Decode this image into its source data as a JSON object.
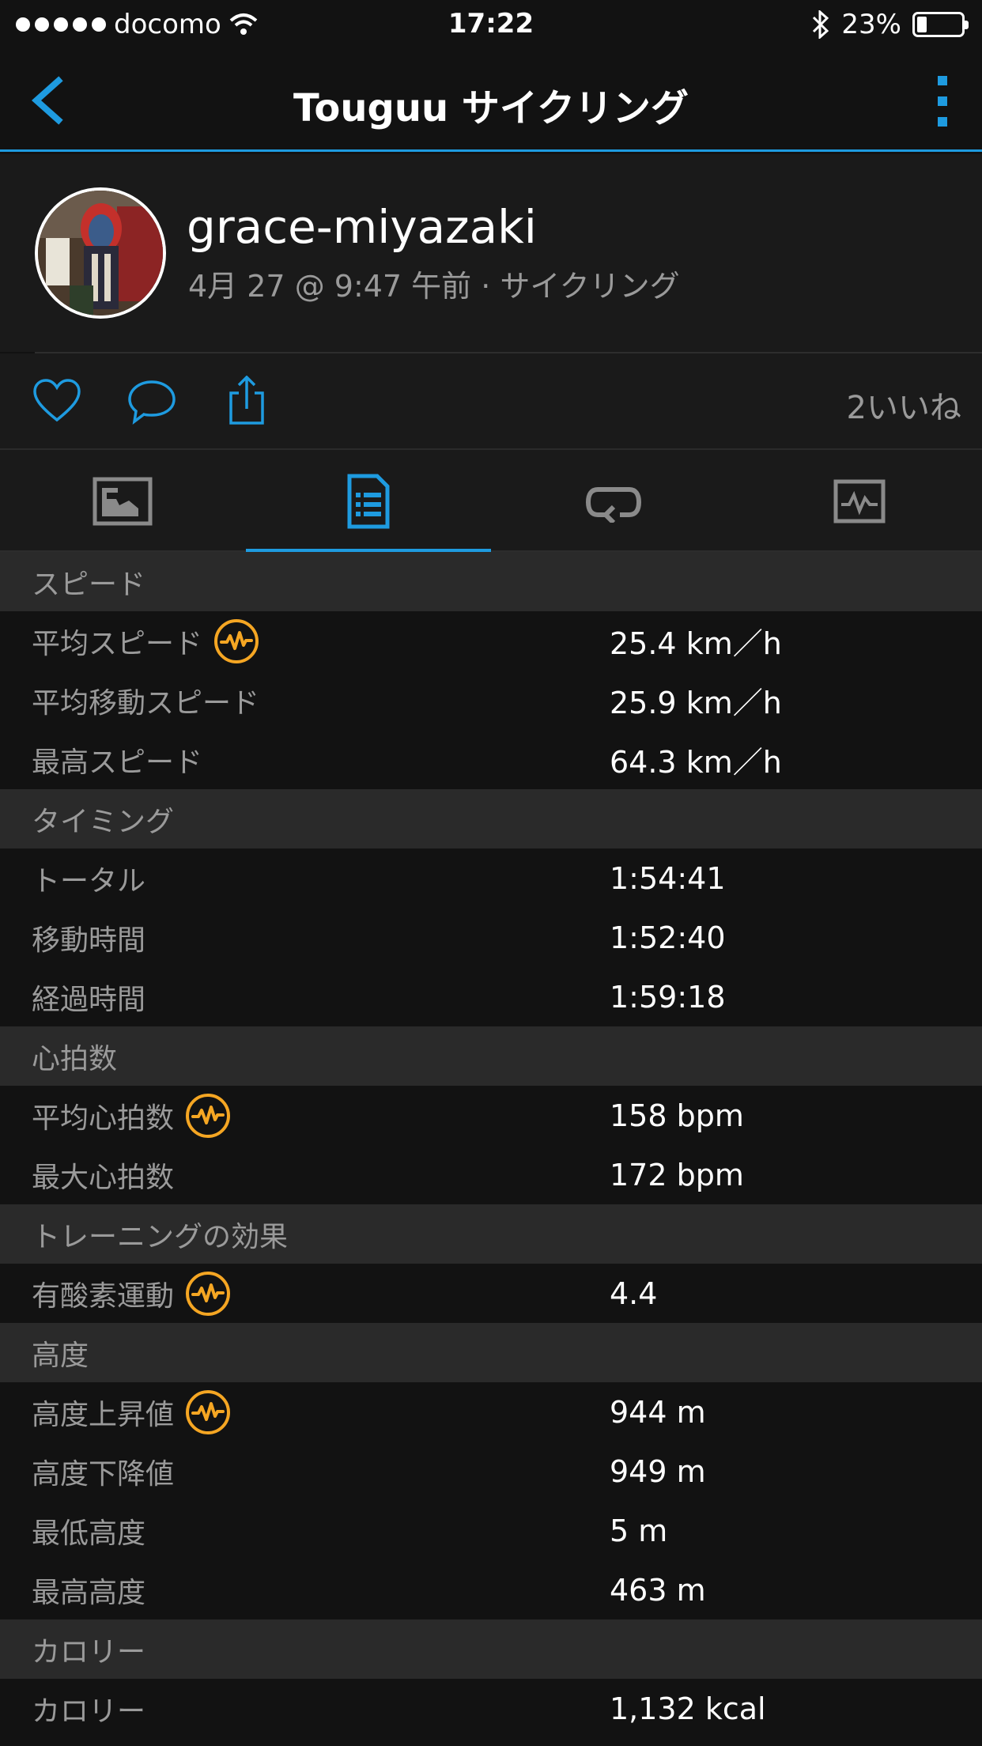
{
  "status_bar": {
    "carrier": "docomo",
    "time": "17:22",
    "battery": "23%",
    "battery_level": 0.23
  },
  "nav": {
    "title": "Touguu サイクリング"
  },
  "profile": {
    "username": "grace-miyazaki",
    "subline": "4月 27 @ 9:47 午前 · サイクリング"
  },
  "actions": {
    "likes": "2いいね"
  },
  "tabs": [
    {
      "name": "map-tab",
      "icon": "map-icon",
      "active": false
    },
    {
      "name": "stats-tab",
      "icon": "document-list-icon",
      "active": true
    },
    {
      "name": "laps-tab",
      "icon": "loop-icon",
      "active": false
    },
    {
      "name": "charts-tab",
      "icon": "chart-pulse-icon",
      "active": false
    }
  ],
  "colors": {
    "accent": "#1e9be0",
    "insight": "#f5a623",
    "background": "#121212",
    "section": "#2a2a2a",
    "label": "#9a9a9a"
  },
  "sections": [
    {
      "title": "スピード",
      "rows": [
        {
          "label": "平均スピード",
          "value": "25.4 km／h",
          "insight": true
        },
        {
          "label": "平均移動スピード",
          "value": "25.9 km／h",
          "insight": false
        },
        {
          "label": "最高スピード",
          "value": "64.3 km／h",
          "insight": false
        }
      ]
    },
    {
      "title": "タイミング",
      "rows": [
        {
          "label": "トータル",
          "value": "1:54:41",
          "insight": false
        },
        {
          "label": "移動時間",
          "value": "1:52:40",
          "insight": false
        },
        {
          "label": "経過時間",
          "value": "1:59:18",
          "insight": false
        }
      ]
    },
    {
      "title": "心拍数",
      "rows": [
        {
          "label": "平均心拍数",
          "value": "158 bpm",
          "insight": true
        },
        {
          "label": "最大心拍数",
          "value": "172 bpm",
          "insight": false
        }
      ]
    },
    {
      "title": "トレーニングの効果",
      "rows": [
        {
          "label": "有酸素運動",
          "value": "4.4",
          "insight": true
        }
      ]
    },
    {
      "title": "高度",
      "rows": [
        {
          "label": "高度上昇値",
          "value": "944 m",
          "insight": true
        },
        {
          "label": "高度下降値",
          "value": "949 m",
          "insight": false
        },
        {
          "label": "最低高度",
          "value": "5 m",
          "insight": false
        },
        {
          "label": "最高高度",
          "value": "463 m",
          "insight": false
        }
      ]
    },
    {
      "title": "カロリー",
      "rows": [
        {
          "label": "カロリー",
          "value": "1,132 kcal",
          "insight": false
        }
      ]
    }
  ]
}
